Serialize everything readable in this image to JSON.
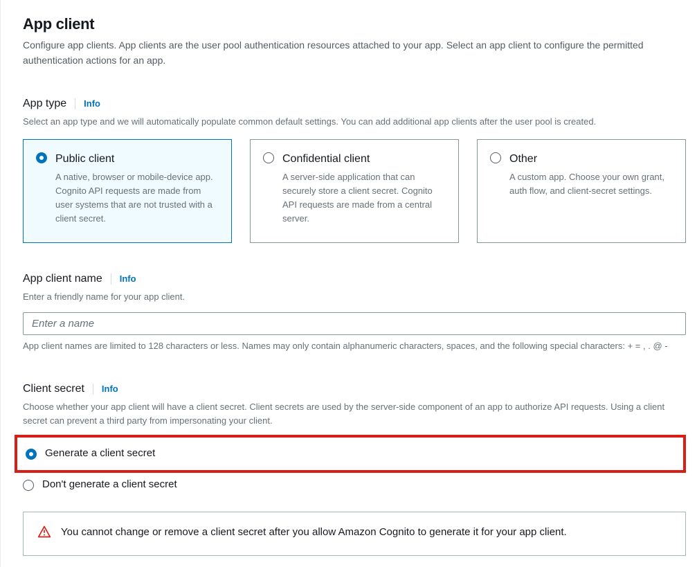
{
  "header": {
    "title": "App client",
    "description": "Configure app clients. App clients are the user pool authentication resources attached to your app. Select an app client to configure the permitted authentication actions for an app."
  },
  "appType": {
    "label": "App type",
    "info": "Info",
    "description": "Select an app type and we will automatically populate common default settings. You can add additional app clients after the user pool is created.",
    "options": [
      {
        "title": "Public client",
        "desc": "A native, browser or mobile-device app. Cognito API requests are made from user systems that are not trusted with a client secret."
      },
      {
        "title": "Confidential client",
        "desc": "A server-side application that can securely store a client secret. Cognito API requests are made from a central server."
      },
      {
        "title": "Other",
        "desc": "A custom app. Choose your own grant, auth flow, and client-secret settings."
      }
    ]
  },
  "appClientName": {
    "label": "App client name",
    "info": "Info",
    "description": "Enter a friendly name for your app client.",
    "placeholder": "Enter a name",
    "value": "",
    "hint": "App client names are limited to 128 characters or less. Names may only contain alphanumeric characters, spaces, and the following special characters: + = , . @ -"
  },
  "clientSecret": {
    "label": "Client secret",
    "info": "Info",
    "description": "Choose whether your app client will have a client secret. Client secrets are used by the server-side component of an app to authorize API requests. Using a client secret can prevent a third party from impersonating your client.",
    "options": {
      "generate": "Generate a client secret",
      "dont": "Don't generate a client secret"
    },
    "alert": "You cannot change or remove a client secret after you allow Amazon Cognito to generate it for your app client."
  }
}
